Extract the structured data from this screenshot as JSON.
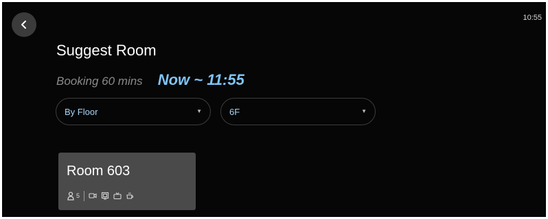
{
  "status_bar": {
    "time": "10:55"
  },
  "header": {
    "back_icon": "chevron-left-icon"
  },
  "page": {
    "title": "Suggest Room",
    "booking_label": "Booking 60 mins",
    "booking_time": "Now ~ 11:55"
  },
  "filters": {
    "floor_mode": {
      "value": "By Floor",
      "icon": "caret-down-icon"
    },
    "floor": {
      "value": "6F",
      "icon": "caret-down-icon"
    }
  },
  "rooms": [
    {
      "name": "Room 603",
      "capacity": "5",
      "amenities": [
        "camera-icon",
        "display-icon",
        "tv-icon",
        "coffee-icon"
      ]
    }
  ],
  "colors": {
    "background": "#060606",
    "accent": "#7fc4f6",
    "select_text": "#a9d4f7",
    "card": "#4a4a4a",
    "back_button": "#3b3b3b"
  }
}
